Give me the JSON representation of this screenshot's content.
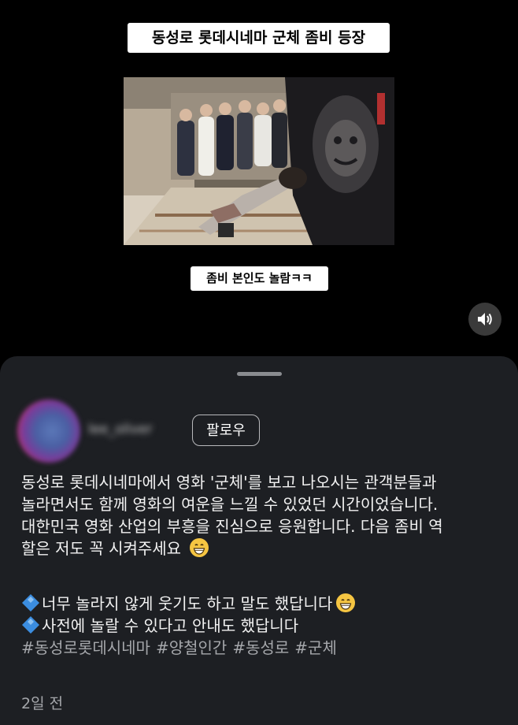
{
  "video": {
    "caption_top": "동성로 롯데시네마 군체 좀비 등장",
    "caption_bottom": "좀비 본인도 놀람ㅋㅋ",
    "sound_icon": "speaker-volume-icon"
  },
  "post": {
    "username": "lee_oliver",
    "follow_label": "팔로우",
    "body_lines": [
      "동성로 롯데시네마에서 영화 '군체'를 보고 나오시는 관객분들과",
      "놀라면서도 함께 영화의 여운을 느낄 수 있었던 시간이었습니다.",
      "대한민국 영화 산업의 부흥을 진심으로 응원합니다. 다음 좀비 역",
      "할은 저도 꼭 시켜주세요"
    ],
    "bullets": [
      "너무 놀라지 않게 웃기도 하고 말도 했답니다",
      "사전에 놀랄 수 있다고 안내도 했답니다"
    ],
    "hashtags": [
      "#동성로롯데시네마",
      "#양철인간",
      "#동성로",
      "#군체"
    ],
    "timestamp": "2일 전"
  },
  "colors": {
    "sheet_bg": "#1d1f23",
    "hashtag": "#a5a7ab",
    "diamond": "#3b8de0",
    "emoji": "#f5c542"
  }
}
